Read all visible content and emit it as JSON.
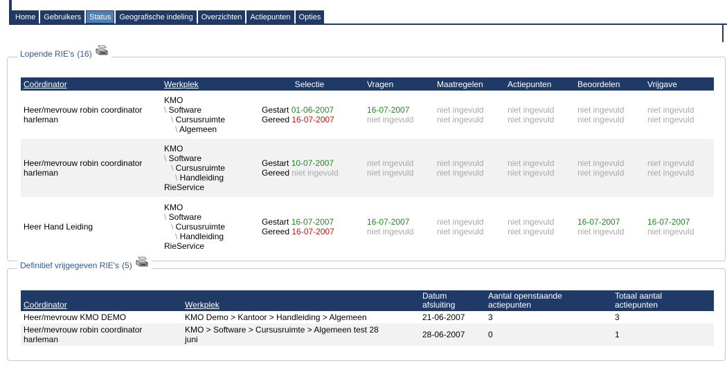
{
  "tabs": [
    {
      "label": "Home",
      "active": false
    },
    {
      "label": "Gebruikers",
      "active": false
    },
    {
      "label": "Status",
      "active": true
    },
    {
      "label": "Geografische indeling",
      "active": false
    },
    {
      "label": "Overzichten",
      "active": false
    },
    {
      "label": "Actiepunten",
      "active": false
    },
    {
      "label": "Opties",
      "active": false
    }
  ],
  "colors": {
    "nav": "#1f3a67",
    "active_tab": "#4f7fb4",
    "link": "#2c5a9c",
    "green": "#228b22",
    "red": "#cc1111",
    "grey": "#a8a8a8"
  },
  "lopende": {
    "legend": "Lopende RIE's",
    "count": "(16)",
    "print_icon": "printer-icon",
    "headers": {
      "coordinator": "Coördinator",
      "werkplek": "Werkplek",
      "selectie": "Selectie",
      "vragen": "Vragen",
      "maatregelen": "Maatregelen",
      "actiepunten": "Actiepunten",
      "beoordelen": "Beoordelen",
      "vrijgave": "Vrijgave"
    },
    "labels": {
      "gestart": "Gestart",
      "gereed": "Gereed"
    },
    "rows": [
      {
        "coordinator": [
          "Heer/mevrouw robin coordinator",
          "harleman"
        ],
        "werkplek": {
          "root": "KMO",
          "l1": "Software",
          "l2": "Cursusruimte",
          "l3": "Algemeen",
          "extra": ""
        },
        "selectie": {
          "gestart": "01-06-2007",
          "gereed": "16-07-2007"
        },
        "vragen": [
          "16-07-2007",
          "niet ingevuld"
        ],
        "maatregelen": [
          "niet ingevuld",
          "niet ingevuld"
        ],
        "actiepunten": [
          "niet ingevuld",
          "niet ingevuld"
        ],
        "beoordelen": [
          "niet ingevuld",
          "niet ingevuld"
        ],
        "vrijgave": [
          "niet ingevuld",
          "niet ingevuld"
        ]
      },
      {
        "coordinator": [
          "Heer/mevrouw robin coordinator",
          "harleman"
        ],
        "werkplek": {
          "root": "KMO",
          "l1": "Software",
          "l2": "Cursusruimte",
          "l3": "Handleiding",
          "extra": "RieService"
        },
        "selectie": {
          "gestart": "10-07-2007",
          "gereed": "niet ingevuld"
        },
        "vragen": [
          "niet ingevuld",
          "niet ingevuld"
        ],
        "maatregelen": [
          "niet ingevuld",
          "niet ingevuld"
        ],
        "actiepunten": [
          "niet ingevuld",
          "niet ingevuld"
        ],
        "beoordelen": [
          "niet ingevuld",
          "niet ingevuld"
        ],
        "vrijgave": [
          "niet ingevuld",
          "niet ingevuld"
        ]
      },
      {
        "coordinator": [
          "Heer Hand Leiding",
          ""
        ],
        "werkplek": {
          "root": "KMO",
          "l1": "Software",
          "l2": "Cursusruimte",
          "l3": "Handleiding",
          "extra": "RieService"
        },
        "selectie": {
          "gestart": "16-07-2007",
          "gereed": "16-07-2007"
        },
        "vragen": [
          "16-07-2007",
          "niet ingevuld"
        ],
        "maatregelen": [
          "niet ingevuld",
          "niet ingevuld"
        ],
        "actiepunten": [
          "niet ingevuld",
          "niet ingevuld"
        ],
        "beoordelen": [
          "16-07-2007",
          "niet ingevuld"
        ],
        "vrijgave": [
          "16-07-2007",
          "niet ingevuld"
        ]
      }
    ]
  },
  "definitief": {
    "legend": "Definitief vrijgegeven RIE's",
    "count": "(5)",
    "print_icon": "printer-icon",
    "headers": {
      "coordinator": "Coördinator",
      "werkplek": "Werkplek",
      "datum": [
        "Datum",
        "afsluiting"
      ],
      "aantal": [
        "Aantal openstaande",
        "actiepunten"
      ],
      "totaal": [
        "Totaal aantal",
        "actiepunten"
      ]
    },
    "rows": [
      {
        "coordinator": [
          "Heer/mevrouw KMO DEMO",
          ""
        ],
        "werkplek": [
          "KMO Demo  > Kantoor > Handleiding > Algemeen",
          ""
        ],
        "datum": "21-06-2007",
        "aantal": "3",
        "totaal": "3"
      },
      {
        "coordinator": [
          "Heer/mevrouw robin coordinator",
          "harleman"
        ],
        "werkplek": [
          "KMO  > Software > Cursusruimte > Algemeen test 28",
          "juni"
        ],
        "datum": "28-06-2007",
        "aantal": "0",
        "totaal": "1"
      }
    ]
  }
}
